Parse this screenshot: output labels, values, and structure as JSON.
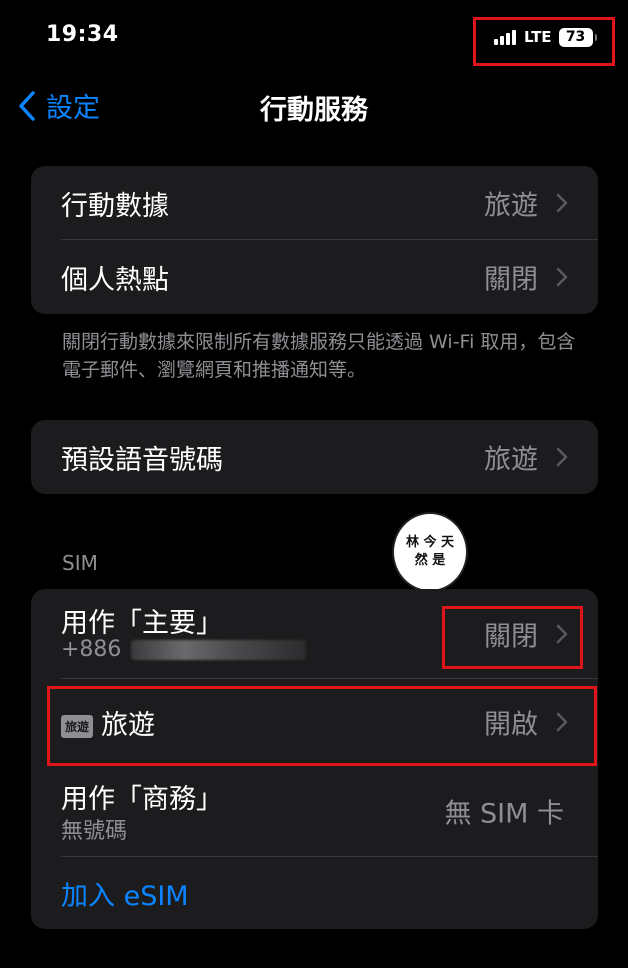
{
  "status_bar": {
    "time": "19:34",
    "network": "LTE",
    "battery": "73",
    "signal_bars": 4
  },
  "nav": {
    "back_label": "設定",
    "title": "行動服務"
  },
  "group1": {
    "rows": [
      {
        "label": "行動數據",
        "value": "旅遊"
      },
      {
        "label": "個人熱點",
        "value": "關閉"
      }
    ],
    "footer": "關閉行動數據來限制所有數據服務只能透過 Wi-Fi 取用，包含電子郵件、瀏覽網頁和推播通知等。"
  },
  "group2": {
    "rows": [
      {
        "label": "預設語音號碼",
        "value": "旅遊"
      }
    ]
  },
  "sim_section": {
    "header": "SIM",
    "primary": {
      "label": "用作「主要」",
      "sub": "+886",
      "value": "關閉"
    },
    "travel": {
      "tag": "旅遊",
      "label": "旅遊",
      "value": "開啟"
    },
    "business": {
      "label": "用作「商務」",
      "sub": "無號碼",
      "value": "無 SIM 卡"
    },
    "add_esim": "加入 eSIM"
  },
  "watermark": {
    "line1": "林 今 天",
    "line2": "然 是"
  },
  "colors": {
    "accent": "#0a84ff",
    "background": "#000000",
    "cell": "#1c1c1e",
    "secondary_text": "#8e8e93",
    "highlight": "#e0141b"
  }
}
